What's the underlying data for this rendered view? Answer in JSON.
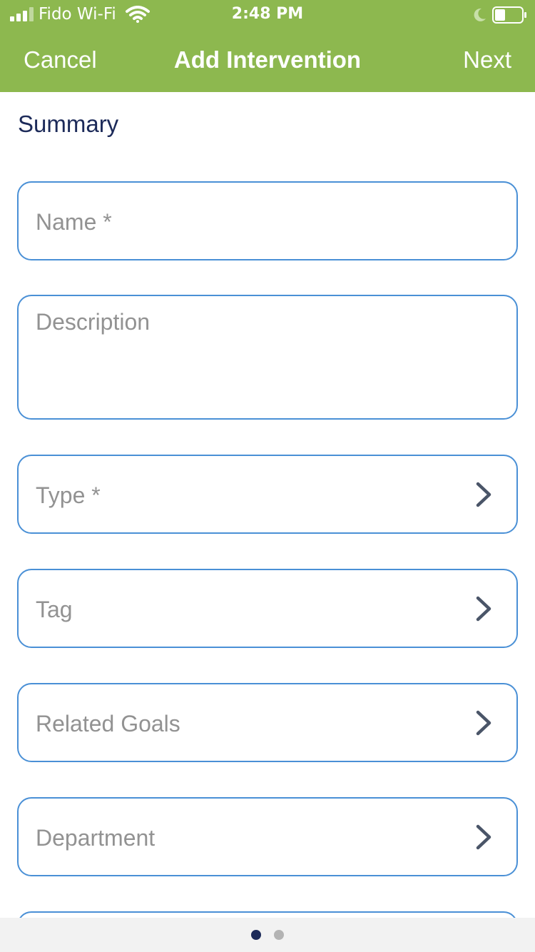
{
  "status_bar": {
    "carrier": "Fido Wi-Fi",
    "time": "2:48 PM",
    "icons": [
      "signal-icon",
      "wifi-icon",
      "moon-icon",
      "battery-icon"
    ]
  },
  "nav": {
    "cancel_label": "Cancel",
    "title": "Add Intervention",
    "next_label": "Next"
  },
  "section": {
    "title": "Summary"
  },
  "fields": {
    "name_placeholder": "Name *",
    "description_placeholder": "Description",
    "type_placeholder": "Type *",
    "tag_placeholder": "Tag",
    "related_goals_placeholder": "Related Goals",
    "department_placeholder": "Department"
  },
  "pager": {
    "page_count": 2,
    "current_page": 1
  },
  "colors": {
    "header_bg": "#8db84f",
    "field_border": "#4a90d6",
    "title_text": "#1c2a59",
    "placeholder_text": "#929292",
    "chevron": "#4a5568"
  }
}
